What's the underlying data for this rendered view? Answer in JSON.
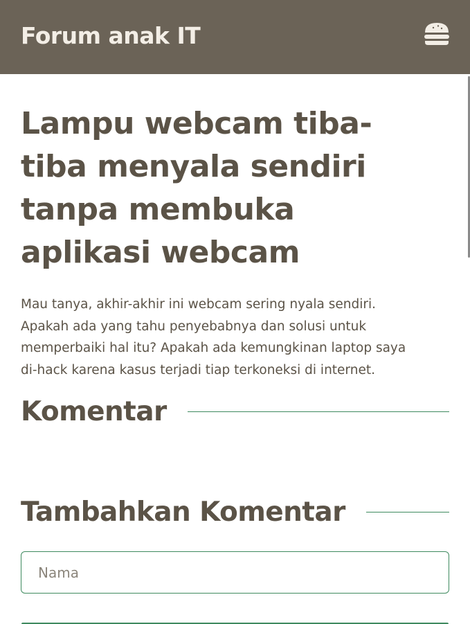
{
  "header": {
    "title": "Forum anak IT",
    "menu_icon": "hamburger-menu-icon"
  },
  "post": {
    "title": "Lampu webcam tiba-tiba menyala sendiri tanpa membuka aplikasi webcam",
    "body": "Mau tanya, akhir-akhir ini webcam sering nyala sendiri. Apakah ada yang tahu penyebabnya dan solusi untuk memperbaiki hal itu? Apakah ada kemungkinan laptop saya di-hack karena kasus terjadi tiap terkoneksi di internet."
  },
  "comments": {
    "heading": "Komentar",
    "items": []
  },
  "add_comment": {
    "heading": "Tambahkan Komentar",
    "name_placeholder": "Nama",
    "name_value": ""
  },
  "colors": {
    "header_bg": "#6b6357",
    "header_text": "#f3eee6",
    "text": "#5b5347",
    "accent_green": "#3f8a5f"
  }
}
